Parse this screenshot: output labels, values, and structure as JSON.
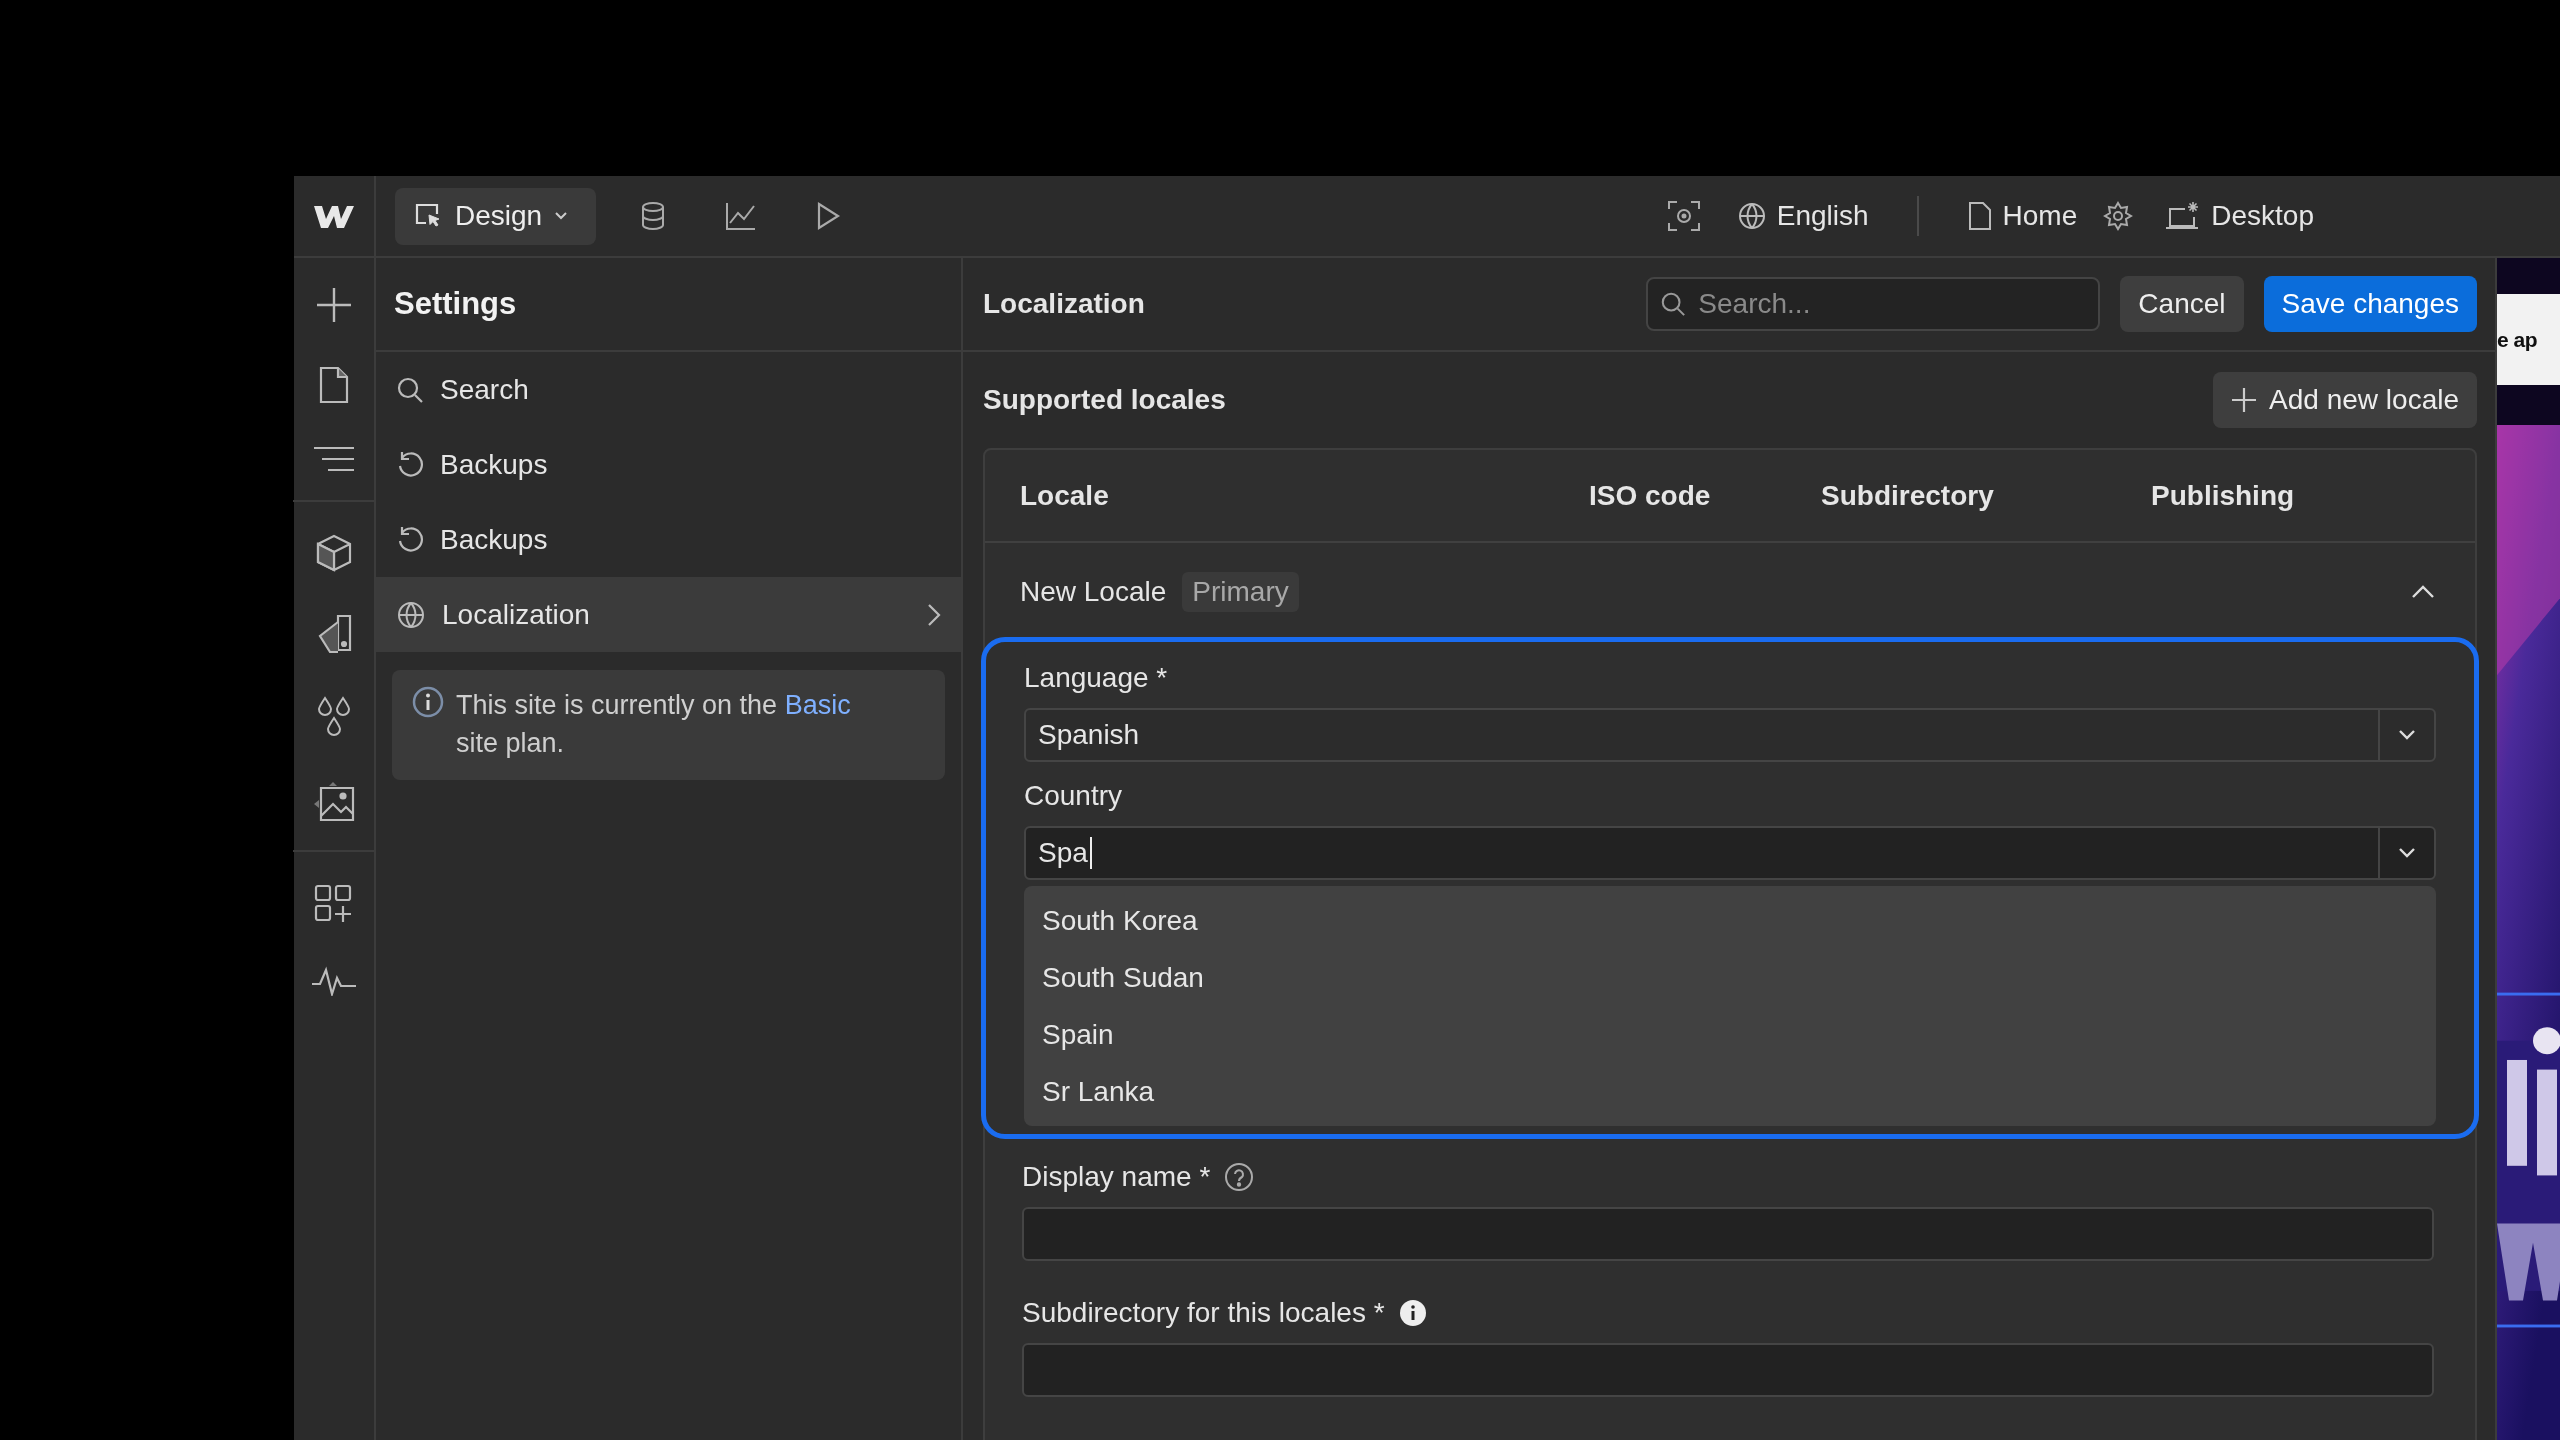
{
  "toolbar": {
    "mode": "Design",
    "language": "English",
    "page": "Home",
    "breakpoint": "Desktop"
  },
  "sidebar": {
    "title": "Settings",
    "items": [
      {
        "label": "Search",
        "kind": "search",
        "selected": false
      },
      {
        "label": "Backups",
        "kind": "backup",
        "selected": false
      },
      {
        "label": "Backups",
        "kind": "backup",
        "selected": false
      },
      {
        "label": "Localization",
        "kind": "globe",
        "selected": true
      }
    ],
    "notice": {
      "before": "This site is currently on the",
      "link": "Basic",
      "after": "site plan."
    }
  },
  "panel": {
    "title": "Localization",
    "search": {
      "placeholder": "Search..."
    },
    "buttons": [
      {
        "label": "Cancel",
        "kind": "secondary"
      },
      {
        "label": "Save changes",
        "kind": "primary"
      }
    ],
    "section_title": "Supported locales",
    "add_button": "Add new locale",
    "table": {
      "columns": [
        "Locale",
        "ISO code",
        "Subdirectory",
        "Publishing"
      ],
      "locale": {
        "name": "New Locale",
        "badge": "Primary",
        "expanded": true
      }
    },
    "form": {
      "focused": true,
      "language": {
        "label": "Language",
        "required_mark": "*",
        "value": "Spanish"
      },
      "country": {
        "label": "Country",
        "value": "Spa",
        "typing": true,
        "options": [
          {
            "label": "South Korea"
          },
          {
            "label": "South Sudan"
          },
          {
            "label": "Spain"
          },
          {
            "label": "Sr Lanka"
          }
        ]
      },
      "display_name": {
        "label": "Display name",
        "required_mark": "*",
        "help": true
      },
      "subdirectory": {
        "label": "Subdirectory for this locales",
        "required_mark": "*",
        "info": true
      }
    }
  },
  "preview": {
    "heading": "e ap"
  }
}
